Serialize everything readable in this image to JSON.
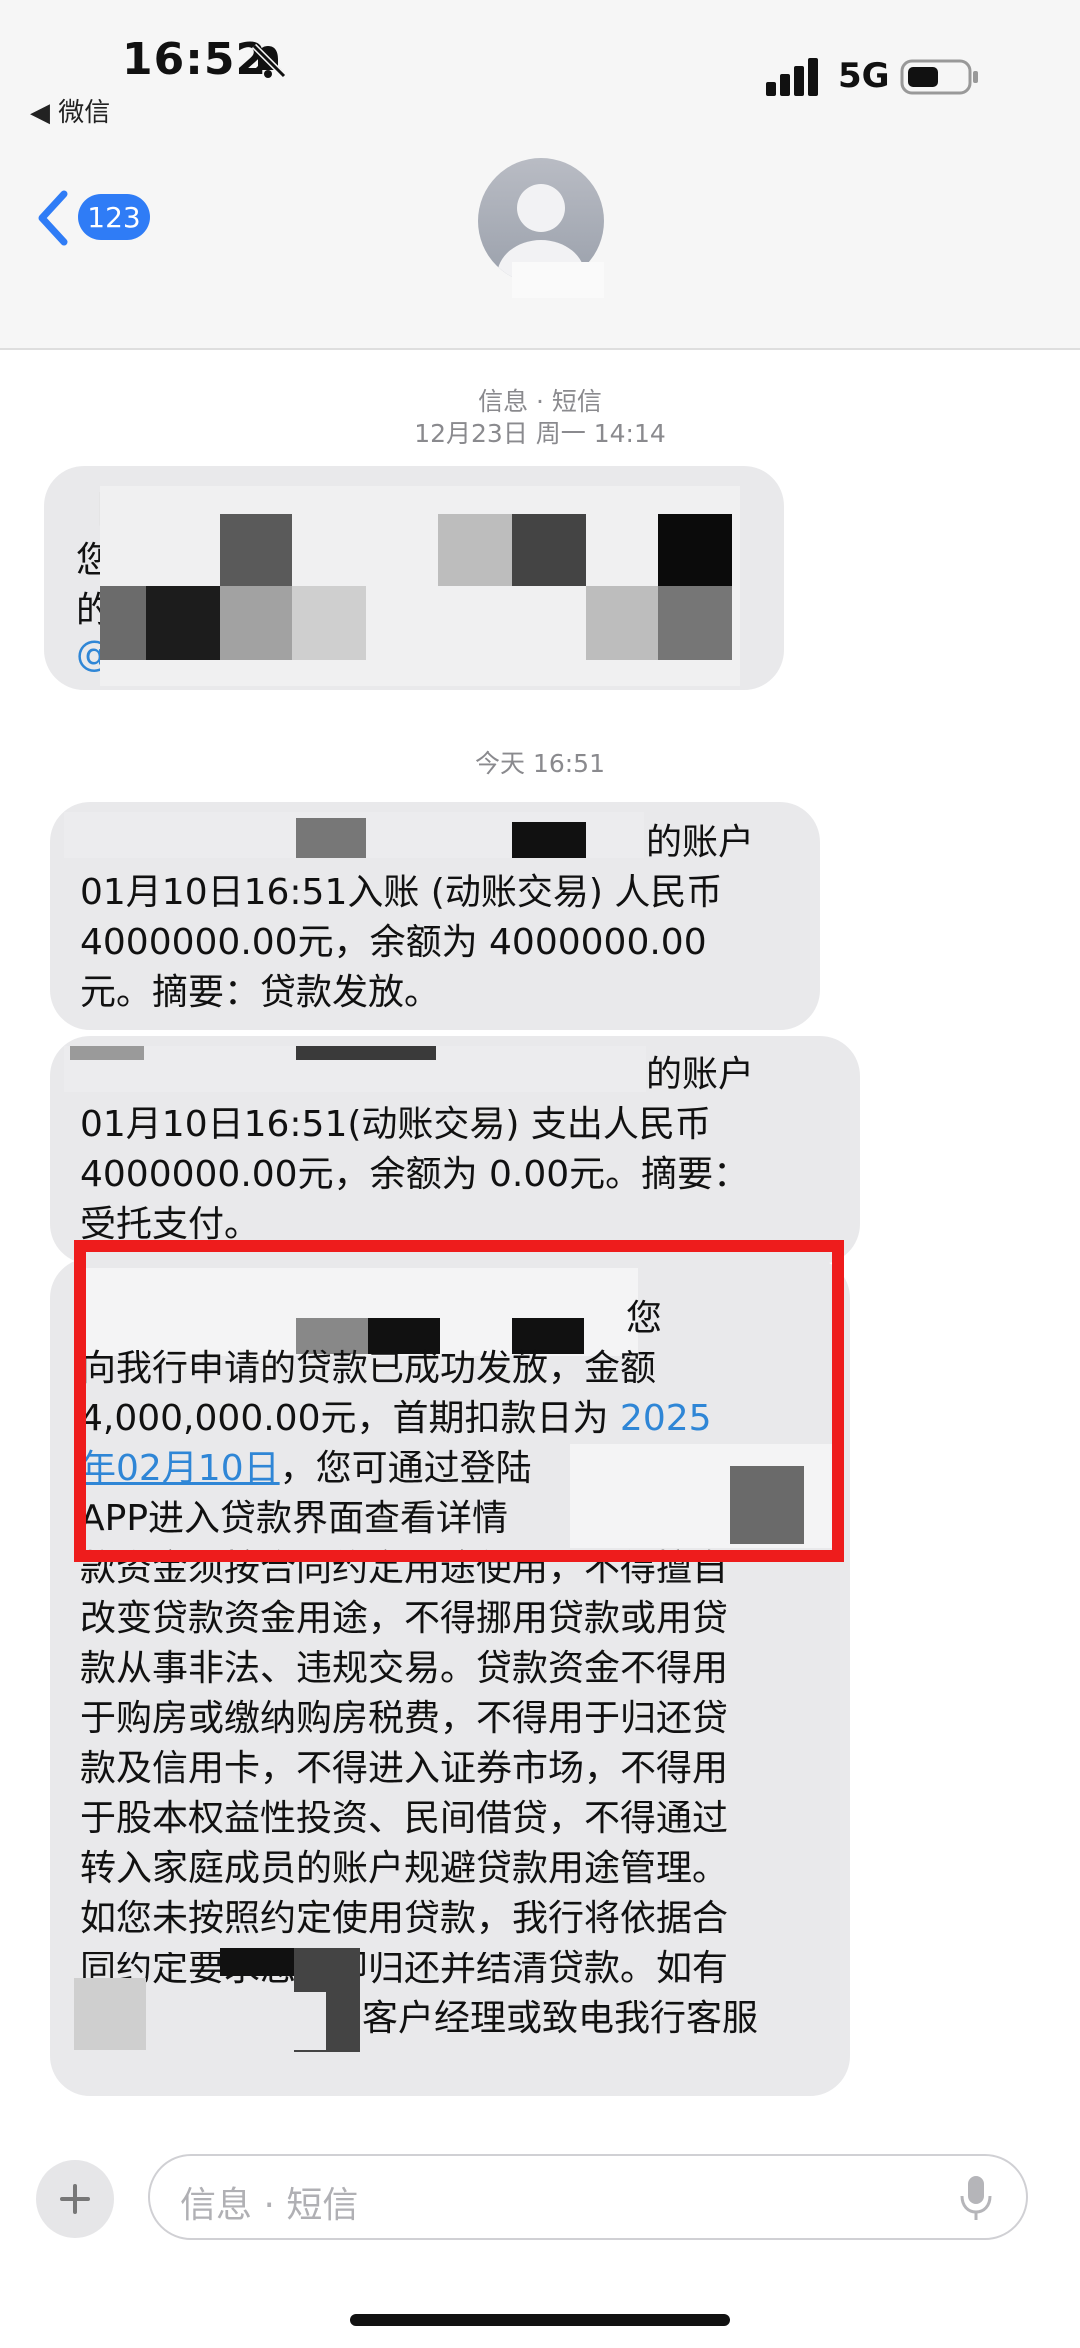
{
  "status_bar": {
    "time": "16:52",
    "back_app": "◀ 微信",
    "network": "5G"
  },
  "nav": {
    "back_count": "123"
  },
  "thread": {
    "channel_label": "信息 · 短信",
    "first_date": "12月23日 周一 14:14",
    "today_time": "今天 16:51"
  },
  "messages": {
    "m1": {
      "lines": [
        "【",
        "您",
        "的",
        "@"
      ]
    },
    "m2": {
      "line1": "的账户",
      "line2": "01月10日16:51入账 (动账交易) 人民币",
      "line3": "4000000.00元，余额为 4000000.00",
      "line4": "元。摘要：贷款发放。"
    },
    "m3": {
      "line1": "的账户",
      "line2": "01月10日16:51(动账交易) 支出人民币",
      "line3": "4000000.00元，余额为 0.00元。摘要：",
      "line4": "受托支付。"
    },
    "m4": {
      "line1": "您",
      "line2": "向我行申请的贷款已成功发放，金额",
      "line3_a": "4,000,000.00元，首期扣款日为 ",
      "line3_link": "2025",
      "line4_link": "年02月10日",
      "line4_b": "，您可通过登陆",
      "line5": "APP进入贷款界面查看详情",
      "line6": "款资金须按合同约定用途使用，不得擅自",
      "line7": "改变贷款资金用途，不得挪用贷款或用贷",
      "line8": "款从事非法、违规交易。贷款资金不得用",
      "line9": "于购房或缴纳购房税费，不得用于归还贷",
      "line10": "款及信用卡，不得进入证券市场，不得用",
      "line11": "于股本权益性投资、民间借贷，不得通过",
      "line12": "转入家庭成员的账户规避贷款用途管理。",
      "line13": "如您未按照约定使用贷款，我行将依据合",
      "line14": "同约定要求您立即归还并结清贷款。如有",
      "line15": "询客户经理或致电我行客服"
    }
  },
  "composer": {
    "placeholder": "信息 · 短信"
  },
  "colors": {
    "accent": "#2f7cf6",
    "link": "#2f86d6",
    "bubble": "#e9e9eb",
    "highlight": "#ee1c1c"
  },
  "icons": [
    "bell-slash-icon",
    "signal-icon",
    "battery-icon",
    "chevron-left-icon",
    "avatar-icon",
    "plus-icon",
    "microphone-icon"
  ]
}
